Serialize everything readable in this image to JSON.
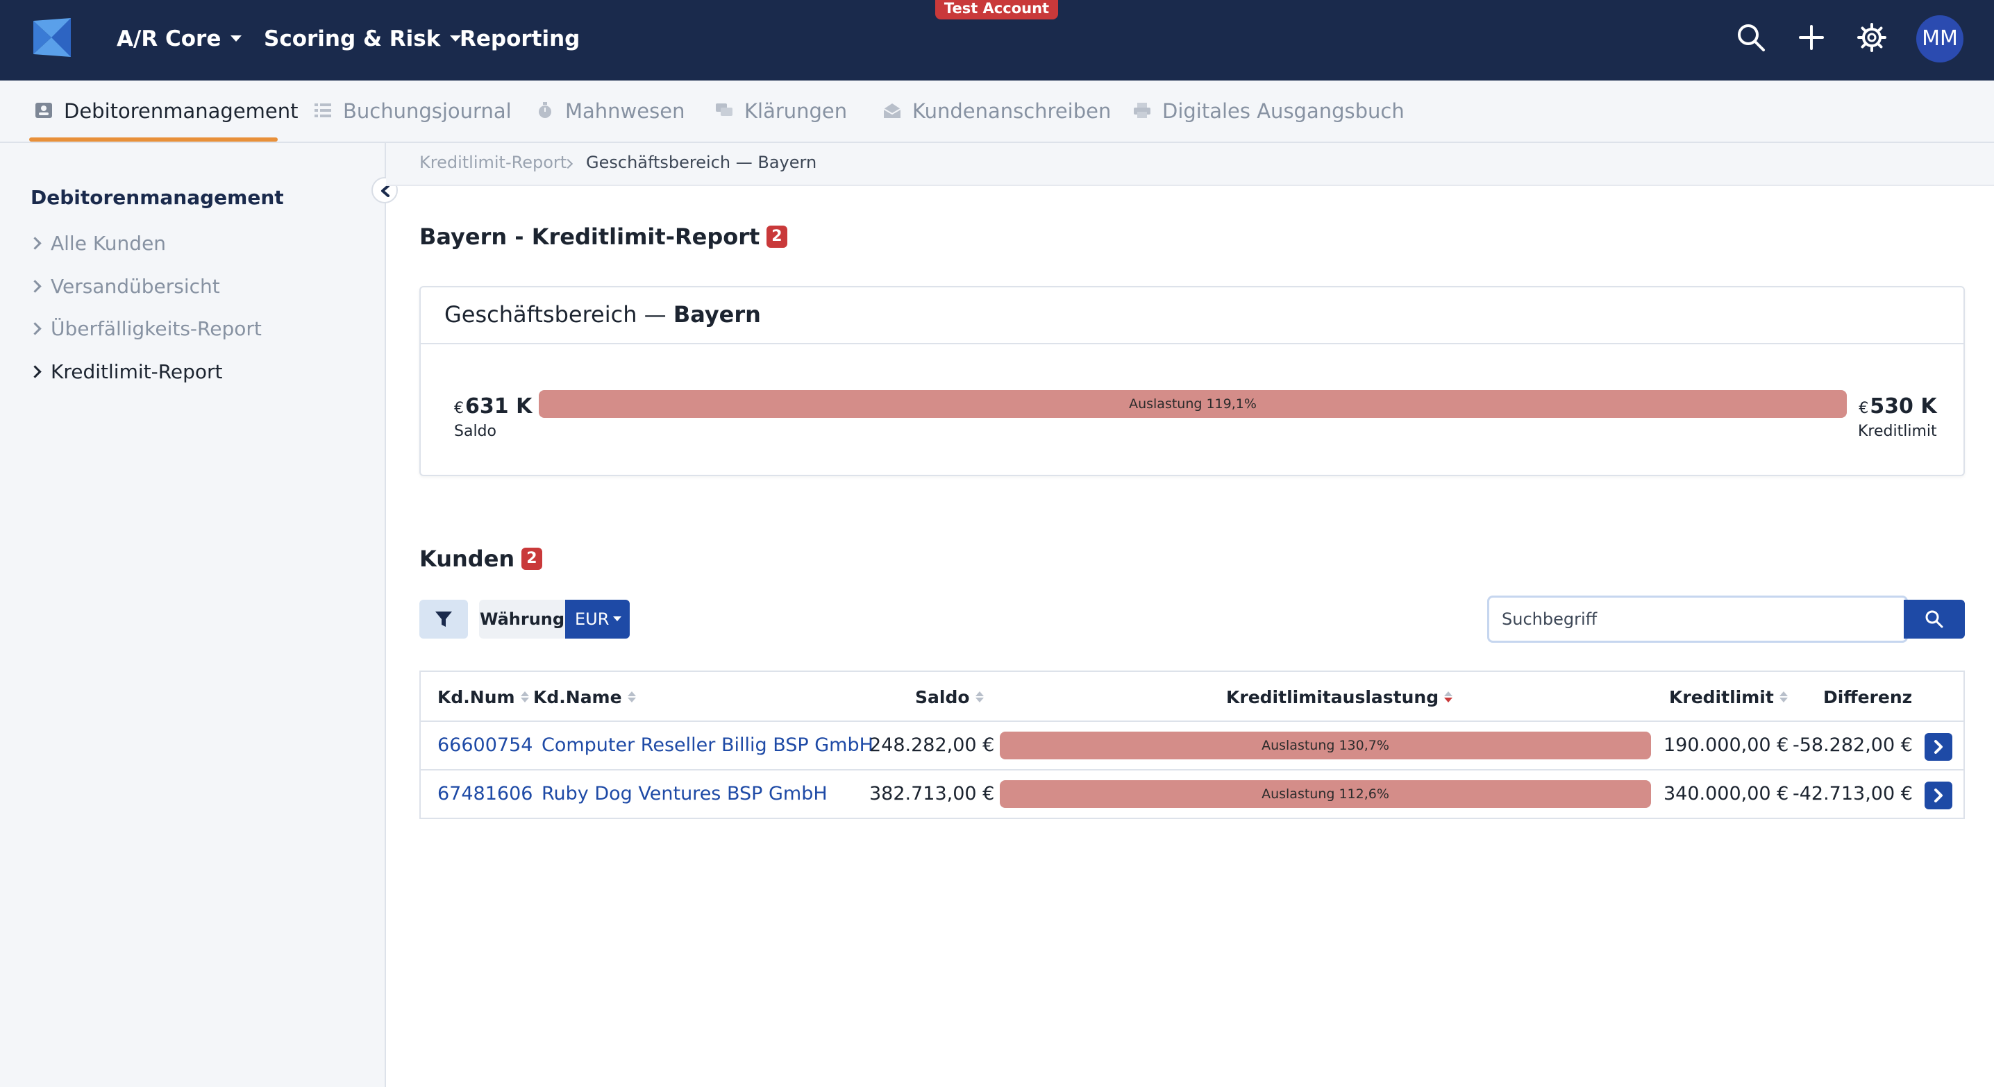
{
  "topbar": {
    "menu": [
      {
        "label": "A/R Core",
        "dropdown": true
      },
      {
        "label": "Scoring & Risk",
        "dropdown": true
      },
      {
        "label": "Reporting",
        "dropdown": false
      }
    ],
    "test_badge": "Test Account",
    "avatar_initials": "MM",
    "icons": [
      "search-icon",
      "plus-icon",
      "gear-icon"
    ]
  },
  "tabs": [
    {
      "label": "Debitorenmanagement",
      "icon": "contact-card-icon",
      "active": true
    },
    {
      "label": "Buchungsjournal",
      "icon": "list-icon",
      "active": false
    },
    {
      "label": "Mahnwesen",
      "icon": "stopwatch-icon",
      "active": false
    },
    {
      "label": "Klärungen",
      "icon": "chat-icon",
      "active": false
    },
    {
      "label": "Kundenanschreiben",
      "icon": "mail-icon",
      "active": false
    },
    {
      "label": "Digitales Ausgangsbuch",
      "icon": "printer-icon",
      "active": false
    }
  ],
  "sidebar": {
    "title": "Debitorenmanagement",
    "items": [
      {
        "label": "Alle Kunden",
        "active": false
      },
      {
        "label": "Versandübersicht",
        "active": false
      },
      {
        "label": "Überfälligkeits-Report",
        "active": false
      },
      {
        "label": "Kreditlimit-Report",
        "active": true
      }
    ]
  },
  "breadcrumb": {
    "items": [
      "Kreditlimit-Report",
      "Geschäftsbereich — Bayern"
    ]
  },
  "page": {
    "title": "Bayern - Kreditlimit-Report",
    "count": "2"
  },
  "summary": {
    "title_prefix": "Geschäftsbereich — ",
    "title_bold": "Bayern",
    "saldo_currency": "€",
    "saldo_amount": "631 K",
    "saldo_label": "Saldo",
    "limit_currency": "€",
    "limit_amount": "530 K",
    "limit_label": "Kreditlimit",
    "utilization_text": "Auslastung 119,1%",
    "utilization_pct": 119.1
  },
  "kunden": {
    "title": "Kunden",
    "count": "2",
    "currency_label": "Währung",
    "currency_value": "EUR",
    "search_placeholder": "Suchbegriff"
  },
  "table": {
    "headers": {
      "kdnum": "Kd.Num",
      "kdname": "Kd.Name",
      "saldo": "Saldo",
      "auslastung": "Kreditlimitauslastung",
      "kreditlimit": "Kreditlimit",
      "differenz": "Differenz"
    },
    "sorted_column": "auslastung",
    "sort_direction": "desc",
    "rows": [
      {
        "kdnum": "66600754",
        "kdname": "Computer Reseller Billig BSP GmbH",
        "saldo": "248.282,00 €",
        "auslastung_text": "Auslastung 130,7%",
        "auslastung_pct": 130.7,
        "kreditlimit": "190.000,00 €",
        "differenz": "-58.282,00 €"
      },
      {
        "kdnum": "67481606",
        "kdname": "Ruby Dog Ventures BSP GmbH",
        "saldo": "382.713,00 €",
        "auslastung_text": "Auslastung 112,6%",
        "auslastung_pct": 112.6,
        "kreditlimit": "340.000,00 €",
        "differenz": "-42.713,00 €"
      }
    ]
  },
  "colors": {
    "navbar": "#1a2a4c",
    "primary": "#1e4aa6",
    "danger_badge": "#c9393a",
    "tab_active_underline": "#e8903a",
    "utilization_bar": "#d48d89",
    "sidebar_bg": "#f4f6f9"
  }
}
